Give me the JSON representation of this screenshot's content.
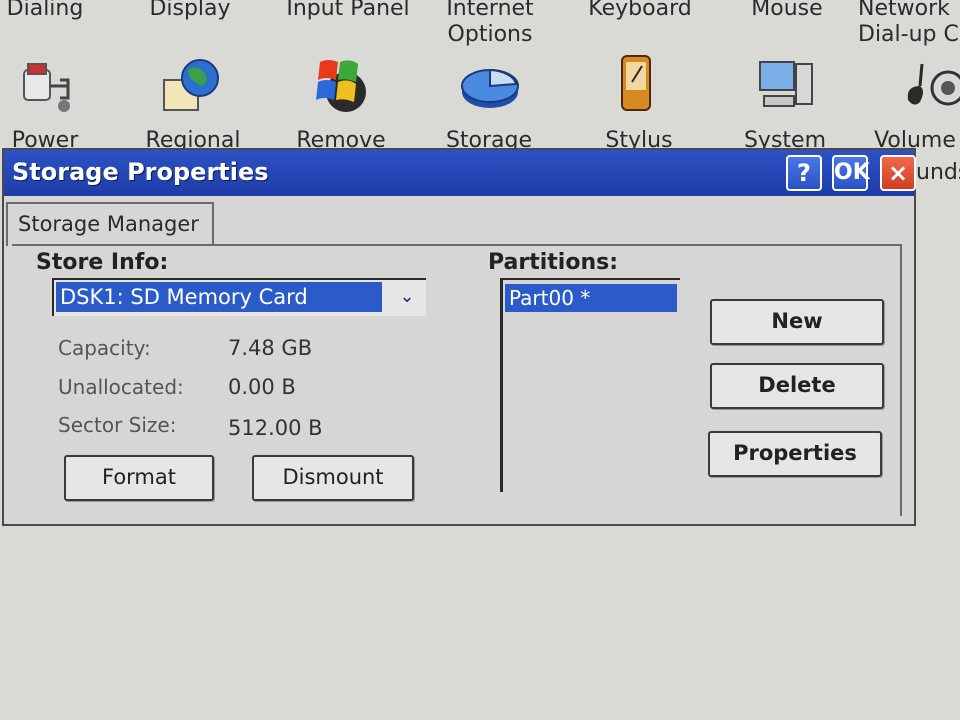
{
  "control_panel": {
    "top_row": [
      "Dialing",
      "Display",
      "Input Panel",
      "Internet Options",
      "Keyboard",
      "Mouse",
      "Network Dial-up C"
    ],
    "icon_row": [
      {
        "label": "Power",
        "icon": "power-icon"
      },
      {
        "label": "Regional",
        "icon": "globe-icon"
      },
      {
        "label": "Remove",
        "icon": "windows-flag-icon"
      },
      {
        "label": "Storage",
        "icon": "pie-chart-icon"
      },
      {
        "label": "Stylus",
        "icon": "pda-icon"
      },
      {
        "label": "System",
        "icon": "computer-icon"
      },
      {
        "label": "Volume",
        "icon": "speaker-icon"
      }
    ],
    "partial_label": "unds"
  },
  "dialog": {
    "title": "Storage Properties",
    "help_label": "?",
    "ok_label": "OK",
    "close_label": "×",
    "tab_label": "Storage Manager",
    "store_info_label": "Store Info:",
    "store_selected": "DSK1: SD Memory Card",
    "dropdown_glyph": "⌄",
    "info": [
      {
        "label": "Capacity:",
        "value": "7.48 GB"
      },
      {
        "label": "Unallocated:",
        "value": "0.00 B"
      },
      {
        "label": "Sector Size:",
        "value": "512.00 B"
      }
    ],
    "format_label": "Format",
    "dismount_label": "Dismount",
    "partitions_label": "Partitions:",
    "partitions": [
      "Part00 *"
    ],
    "new_label": "New",
    "delete_label": "Delete",
    "properties_label": "Properties"
  },
  "colors": {
    "titlebar": "#2d52c4",
    "selection": "#2a5bc8",
    "close_button": "#d23c22",
    "dialog_bg": "#d6d6d4"
  }
}
